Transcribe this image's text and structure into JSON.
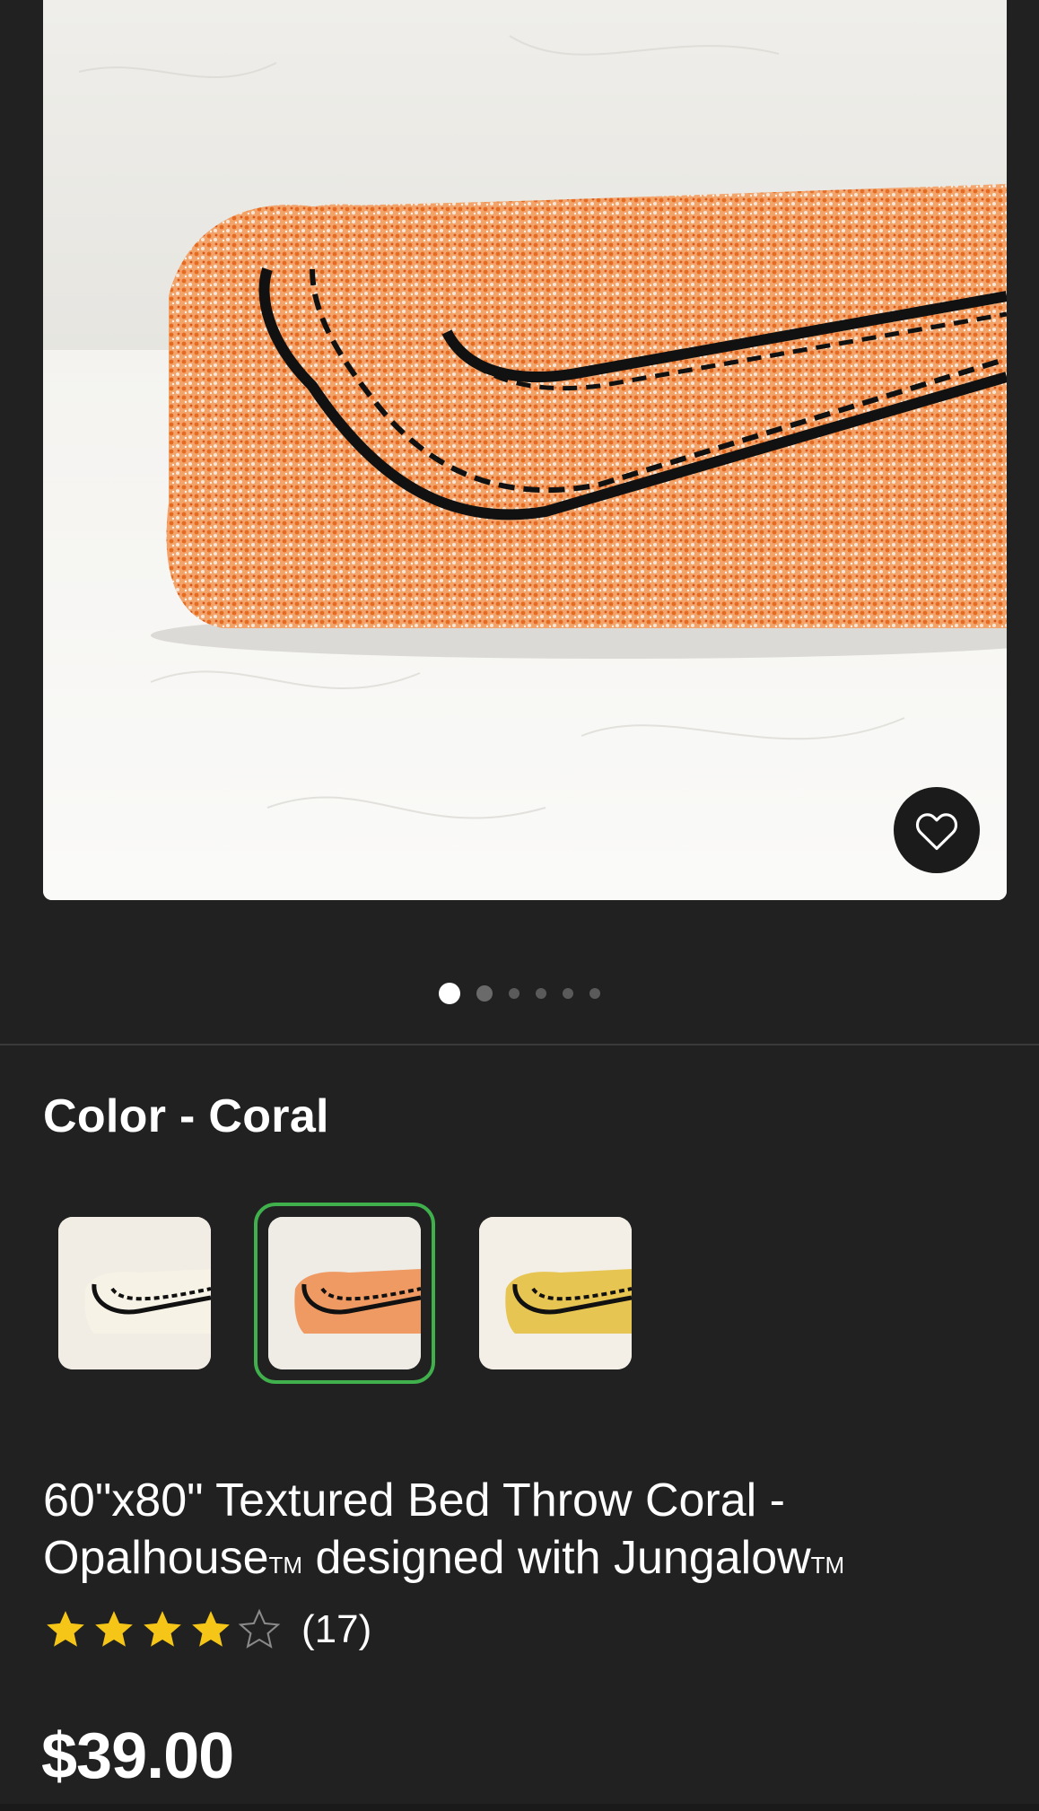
{
  "product": {
    "image_alt": "Textured bed throw folded, coral color with black crochet trim",
    "favorite_icon": "heart-outline-icon",
    "carousel": {
      "total": 6,
      "active": 0
    },
    "color": {
      "label": "Color - Coral",
      "options": [
        {
          "name": "Cream",
          "selected": false
        },
        {
          "name": "Coral",
          "selected": true
        },
        {
          "name": "Yellow",
          "selected": false
        }
      ],
      "selected_ring_color": "#3fb04c"
    },
    "title_line1": "60\"x80\" Textured Bed Throw Coral -",
    "title_brand": "Opalhouse",
    "title_mid": " designed with Jungalow",
    "trademark": "TM",
    "rating": {
      "stars": 4,
      "max": 5,
      "count_text": "(17)",
      "star_color": "#f5c518"
    },
    "price": "$39.00"
  }
}
